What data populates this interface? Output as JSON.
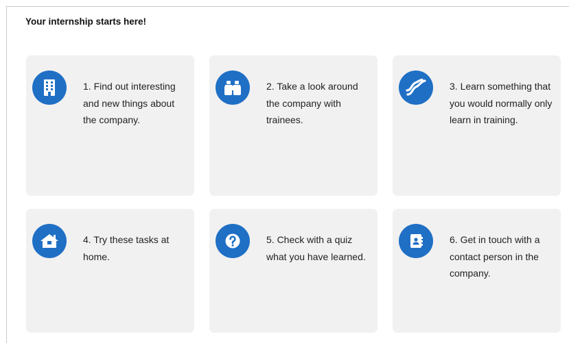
{
  "page": {
    "title": "Your internship starts here!"
  },
  "theme": {
    "accent": "#1f6fc5",
    "card_background": "#f1f1f1"
  },
  "cards": [
    {
      "icon": "building-icon",
      "text": "1. Find out interesting and new things about the company."
    },
    {
      "icon": "binoculars-icon",
      "text": "2. Take a look around the company with trainees."
    },
    {
      "icon": "wave-icon",
      "text": "3. Learn something that you would normally only learn in training."
    },
    {
      "icon": "home-icon",
      "text": "4. Try these tasks at home."
    },
    {
      "icon": "question-icon",
      "text": "5. Check with a quiz what you have learned."
    },
    {
      "icon": "contact-book-icon",
      "text": "6. Get in touch with a contact person in the company."
    }
  ]
}
